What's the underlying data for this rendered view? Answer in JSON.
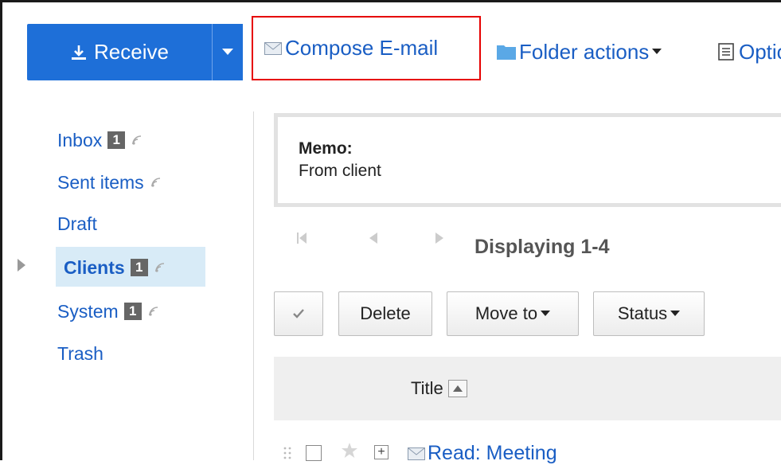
{
  "toolbar": {
    "receive_label": "Receive",
    "compose_label": "Compose E-mail",
    "folder_actions_label": "Folder actions",
    "options_label": "Options"
  },
  "sidebar": {
    "items": [
      {
        "label": "Inbox",
        "badge": "1",
        "rss": true
      },
      {
        "label": "Sent items",
        "badge": "",
        "rss": true
      },
      {
        "label": "Draft",
        "badge": "",
        "rss": false
      },
      {
        "label": "Clients",
        "badge": "1",
        "rss": true,
        "selected": true
      },
      {
        "label": "System",
        "badge": "1",
        "rss": true
      },
      {
        "label": "Trash",
        "badge": "",
        "rss": false
      }
    ]
  },
  "memo": {
    "label": "Memo:",
    "text": "From client"
  },
  "pager": {
    "status": "Displaying 1-4"
  },
  "actions": {
    "delete_label": "Delete",
    "move_label": "Move to",
    "status_label": "Status"
  },
  "table": {
    "title_header": "Title",
    "rows": [
      {
        "title": "Read: Meeting"
      }
    ]
  },
  "colors": {
    "primary": "#1e6fd8",
    "link": "#1a5ec4",
    "highlight_border": "#e60000",
    "selected_bg": "#d8ebf7",
    "badge": "#666666"
  }
}
